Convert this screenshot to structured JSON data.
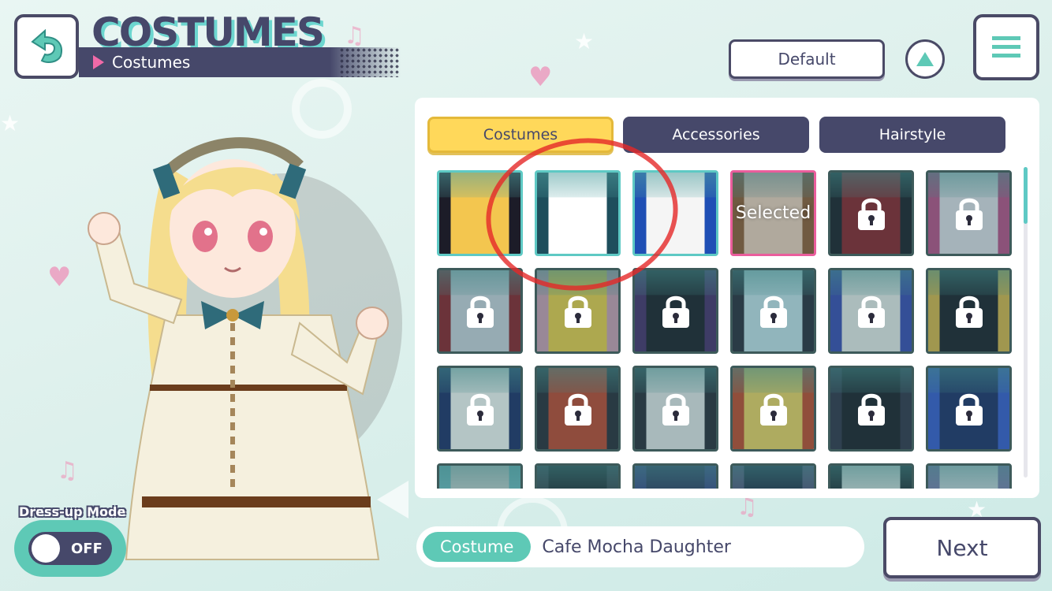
{
  "header": {
    "title": "COSTUMES",
    "subtitle": "Costumes",
    "default_label": "Default"
  },
  "tabs": [
    {
      "label": "Costumes",
      "active": true
    },
    {
      "label": "Accessories",
      "active": false
    },
    {
      "label": "Hairstyle",
      "active": false
    }
  ],
  "grid": {
    "selected_label": "Selected",
    "tiles": [
      {
        "state": "unlocked",
        "colors": [
          "#f3c64f",
          "#1c1c28",
          "#ffffff"
        ]
      },
      {
        "state": "unlocked",
        "colors": [
          "#ffffff",
          "#1e4e5c",
          "#9ad7e6"
        ]
      },
      {
        "state": "unlocked",
        "colors": [
          "#f5f5f5",
          "#1f4fb5",
          "#1c1c28"
        ]
      },
      {
        "state": "selected",
        "colors": [
          "#efe4c6",
          "#8c6a3a",
          "#a6d1c6"
        ]
      },
      {
        "state": "locked",
        "colors": [
          "#8f1f2a",
          "#1c1c28",
          "#d9d9d9"
        ]
      },
      {
        "state": "locked",
        "colors": [
          "#e9e4ee",
          "#c04f8a",
          "#3a8080"
        ]
      },
      {
        "state": "locked",
        "colors": [
          "#d1d7e4",
          "#8f1f2a",
          "#1c1c28"
        ]
      },
      {
        "state": "locked",
        "colors": [
          "#f4d34a",
          "#d6a2b8",
          "#b33b3b"
        ]
      },
      {
        "state": "locked",
        "colors": [
          "#1c1c28",
          "#4b2d6e",
          "#2c2c3c"
        ]
      },
      {
        "state": "locked",
        "colors": [
          "#c9e7f1",
          "#2c2c3c",
          "#ffffff"
        ]
      },
      {
        "state": "locked",
        "colors": [
          "#f1f1f1",
          "#3b4ab8",
          "#a5c4f0"
        ]
      },
      {
        "state": "locked",
        "colors": [
          "#1c1c28",
          "#e0b94a",
          "#3a3a4a"
        ]
      },
      {
        "state": "locked",
        "colors": [
          "#ffffff",
          "#1e2d6b",
          "#9bd7e5"
        ]
      },
      {
        "state": "locked",
        "colors": [
          "#c7452e",
          "#2a2a38",
          "#e6d2c0"
        ]
      },
      {
        "state": "locked",
        "colors": [
          "#ededf0",
          "#2a2a38",
          "#c6c6d0"
        ]
      },
      {
        "state": "locked",
        "colors": [
          "#f6d865",
          "#c8492c",
          "#ffffff"
        ]
      },
      {
        "state": "locked",
        "colors": [
          "#1c1c28",
          "#33334a",
          "#2a2a38"
        ]
      },
      {
        "state": "locked",
        "colors": [
          "#1e2d6b",
          "#3a5bd6",
          "#1c1c28"
        ]
      },
      {
        "state": "partial",
        "colors": [
          "#e0e0e0",
          "#78c6cf",
          "#1c1c28"
        ]
      },
      {
        "state": "partial",
        "colors": [
          "#1c1c28",
          "#3a3a4a",
          "#d9d9d9"
        ]
      },
      {
        "state": "partial",
        "colors": [
          "#2c2c5c",
          "#3b3b8a",
          "#d6d6e8"
        ]
      },
      {
        "state": "partial",
        "colors": [
          "#1c1c3c",
          "#5a4a7a",
          "#9a9ab0"
        ]
      },
      {
        "state": "partial",
        "colors": [
          "#f0f0f0",
          "#1c1c28",
          "#a9dcd1"
        ]
      },
      {
        "state": "partial",
        "colors": [
          "#e6e6f0",
          "#8a7ab8",
          "#2a2a38"
        ]
      }
    ]
  },
  "info_bar": {
    "badge": "Costume",
    "name": "Cafe Mocha Daughter"
  },
  "next_label": "Next",
  "dress_up": {
    "label": "Dress-up Mode",
    "state": "OFF"
  },
  "colors": {
    "navy": "#46486a",
    "teal": "#5ec9b6",
    "yellow": "#ffd85a",
    "pink": "#ea5d9c",
    "annotation_red": "#e52828"
  }
}
